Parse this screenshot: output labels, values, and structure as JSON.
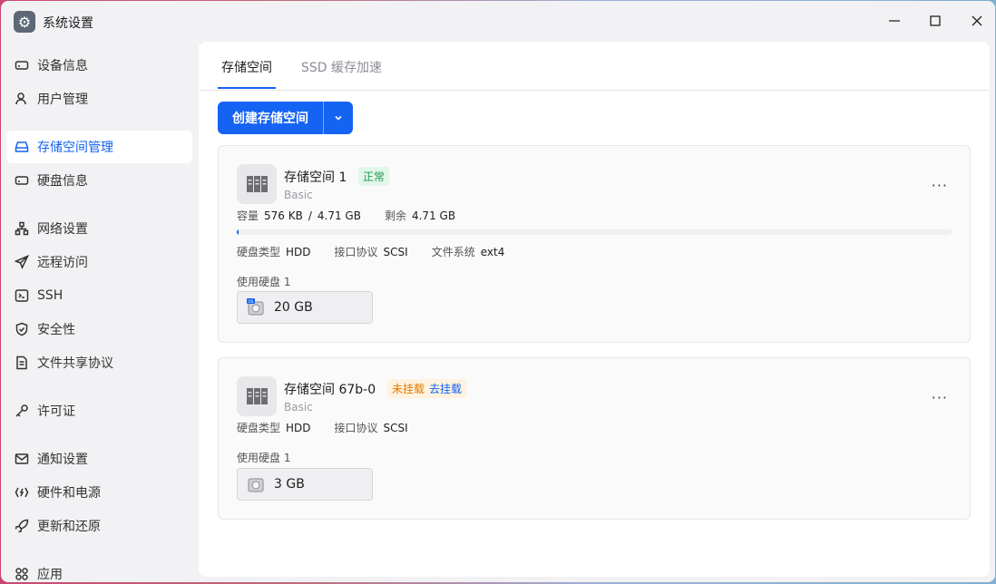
{
  "window": {
    "title": "系统设置",
    "icon": "gear-icon",
    "controls": {
      "minimize": "—",
      "maximize": "☐",
      "close": "✕"
    }
  },
  "sidebar": {
    "items": [
      {
        "label": "设备信息",
        "icon": "device-icon",
        "active": false
      },
      {
        "label": "用户管理",
        "icon": "user-icon",
        "active": false
      },
      {
        "label": "存储空间管理",
        "icon": "storage-icon",
        "active": true
      },
      {
        "label": "硬盘信息",
        "icon": "disk-icon",
        "active": false
      },
      {
        "label": "网络设置",
        "icon": "network-icon",
        "active": false
      },
      {
        "label": "远程访问",
        "icon": "send-icon",
        "active": false
      },
      {
        "label": "SSH",
        "icon": "terminal-icon",
        "active": false
      },
      {
        "label": "安全性",
        "icon": "shield-icon",
        "active": false
      },
      {
        "label": "文件共享协议",
        "icon": "document-icon",
        "active": false
      },
      {
        "label": "许可证",
        "icon": "key-icon",
        "active": false
      },
      {
        "label": "通知设置",
        "icon": "mail-icon",
        "active": false
      },
      {
        "label": "硬件和电源",
        "icon": "hardware-icon",
        "active": false
      },
      {
        "label": "更新和还原",
        "icon": "rocket-icon",
        "active": false
      },
      {
        "label": "应用",
        "icon": "apps-icon",
        "active": false
      }
    ]
  },
  "tabs": [
    {
      "label": "存储空间",
      "active": true
    },
    {
      "label": "SSD 缓存加速",
      "active": false
    }
  ],
  "create_button": {
    "label": "创建存储空间",
    "dropdown_icon": "chevron-down-icon"
  },
  "volumes": [
    {
      "name": "存储空间 1",
      "status": "正常",
      "type": "Basic",
      "capacity_label": "容量",
      "capacity_used": "576 KB",
      "capacity_sep": "/",
      "capacity_total": "4.71 GB",
      "free_label": "剩余",
      "free_value": "4.71 GB",
      "usage_fraction": 0.0001,
      "disk_type_label": "硬盘类型",
      "disk_type": "HDD",
      "interface_label": "接口协议",
      "interface": "SCSI",
      "fs_label": "文件系统",
      "fs": "ext4",
      "disks_label": "使用硬盘 1",
      "disk_size": "20 GB",
      "disk_badge": "OS"
    },
    {
      "name": "存储空间 67b-0",
      "status": "未挂载",
      "status_action": "去挂载",
      "type": "Basic",
      "disk_type_label": "硬盘类型",
      "disk_type": "HDD",
      "interface_label": "接口协议",
      "interface": "SCSI",
      "disks_label": "使用硬盘 1",
      "disk_size": "3 GB"
    }
  ],
  "more_label": "···",
  "colors": {
    "accent": "#1463f3",
    "ok": "#1e9c4f",
    "warn": "#e07b00"
  }
}
